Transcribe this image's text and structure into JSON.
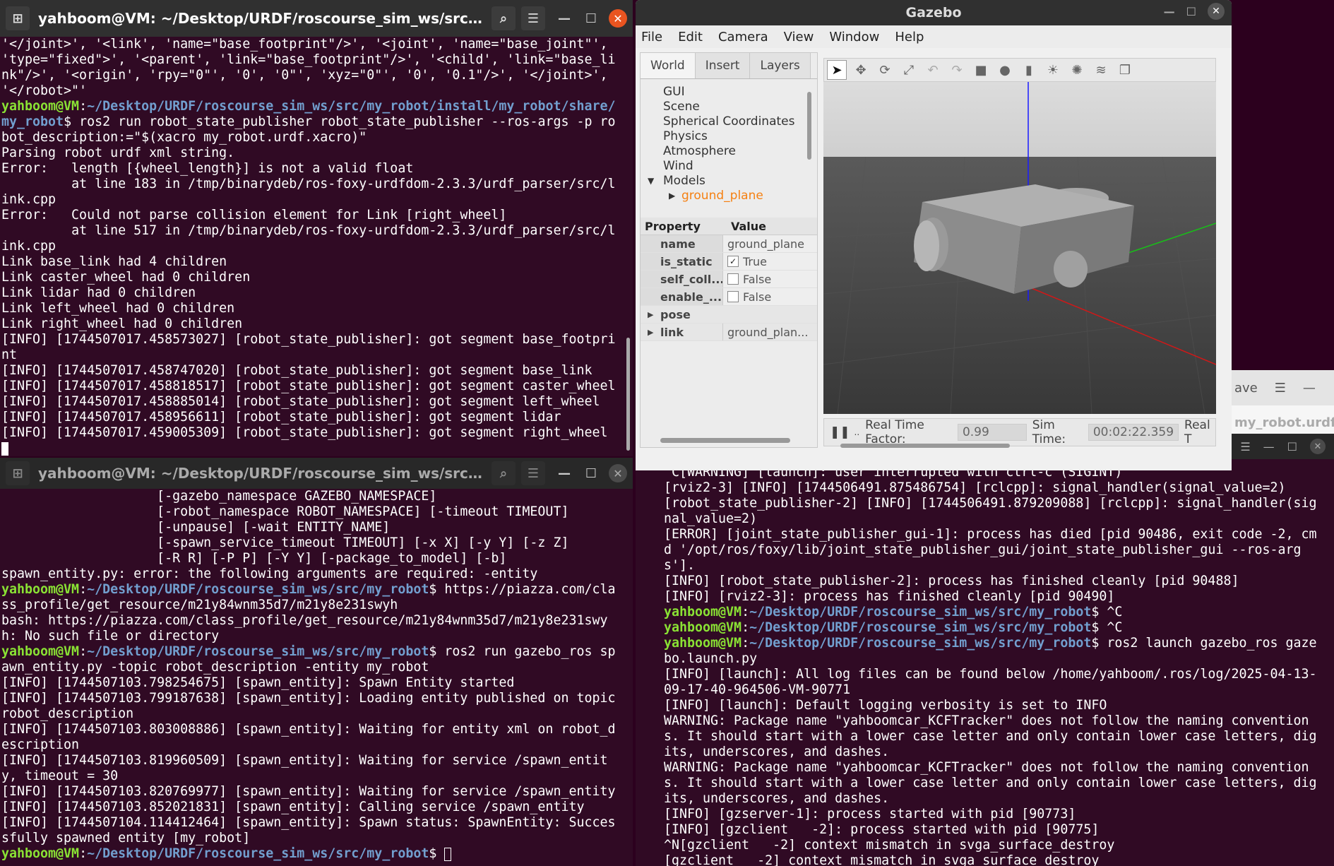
{
  "term1": {
    "title": "yahboom@VM: ~/Desktop/URDF/roscourse_sim_ws/src/my_robot/i...",
    "lines": [
      {
        "t": "'</joint>', '<link', 'name=\"base_footprint\"/>', '<joint', 'name=\"base_joint\"', 'type=\"fixed\">', '<parent', 'link=\"base_footprint\"/>', '<child', 'link=\"base_link\"/>', '<origin', 'rpy=\"0\"', '0', '0\"', 'xyz=\"0\"', '0', '0.1\"/>', '</joint>', '</robot>\"'"
      },
      {
        "user": "yahboom@VM",
        "path": "~/Desktop/URDF/roscourse_sim_ws/src/my_robot/install/my_robot/share/my_robot",
        "cmd": "ros2 run robot_state_publisher robot_state_publisher --ros-args -p robot_description:=\"$(xacro my_robot.urdf.xacro)\""
      },
      {
        "t": "Parsing robot urdf xml string."
      },
      {
        "t": "Error:   length [{wheel_length}] is not a valid float"
      },
      {
        "t": "         at line 183 in /tmp/binarydeb/ros-foxy-urdfdom-2.3.3/urdf_parser/src/link.cpp"
      },
      {
        "t": "Error:   Could not parse collision element for Link [right_wheel]"
      },
      {
        "t": "         at line 517 in /tmp/binarydeb/ros-foxy-urdfdom-2.3.3/urdf_parser/src/link.cpp"
      },
      {
        "t": "Link base_link had 4 children"
      },
      {
        "t": "Link caster_wheel had 0 children"
      },
      {
        "t": "Link lidar had 0 children"
      },
      {
        "t": "Link left_wheel had 0 children"
      },
      {
        "t": "Link right_wheel had 0 children"
      },
      {
        "t": "[INFO] [1744507017.458573027] [robot_state_publisher]: got segment base_footprint"
      },
      {
        "t": "[INFO] [1744507017.458747020] [robot_state_publisher]: got segment base_link"
      },
      {
        "t": "[INFO] [1744507017.458818517] [robot_state_publisher]: got segment caster_wheel"
      },
      {
        "t": "[INFO] [1744507017.458885014] [robot_state_publisher]: got segment left_wheel"
      },
      {
        "t": "[INFO] [1744507017.458956611] [robot_state_publisher]: got segment lidar"
      },
      {
        "t": "[INFO] [1744507017.459005309] [robot_state_publisher]: got segment right_wheel"
      }
    ]
  },
  "term2": {
    "title": "yahboom@VM: ~/Desktop/URDF/roscourse_sim_ws/src/my_robot",
    "lines": [
      {
        "t": "                    [-gazebo_namespace GAZEBO_NAMESPACE]"
      },
      {
        "t": "                    [-robot_namespace ROBOT_NAMESPACE] [-timeout TIMEOUT]"
      },
      {
        "t": "                    [-unpause] [-wait ENTITY_NAME]"
      },
      {
        "t": "                    [-spawn_service_timeout TIMEOUT] [-x X] [-y Y] [-z Z]"
      },
      {
        "t": "                    [-R R] [-P P] [-Y Y] [-package_to_model] [-b]"
      },
      {
        "t": "spawn_entity.py: error: the following arguments are required: -entity"
      },
      {
        "user": "yahboom@VM",
        "path": "~/Desktop/URDF/roscourse_sim_ws/src/my_robot",
        "cmd": "https://piazza.com/class_profile/get_resource/m21y84wnm35d7/m21y8e231swyh"
      },
      {
        "t": "bash: https://piazza.com/class_profile/get_resource/m21y84wnm35d7/m21y8e231swyh: No such file or directory"
      },
      {
        "user": "yahboom@VM",
        "path": "~/Desktop/URDF/roscourse_sim_ws/src/my_robot",
        "cmd": "ros2 run gazebo_ros spawn_entity.py -topic robot_description -entity my_robot"
      },
      {
        "t": "[INFO] [1744507103.798254675] [spawn_entity]: Spawn Entity started"
      },
      {
        "t": "[INFO] [1744507103.799187638] [spawn_entity]: Loading entity published on topic robot_description"
      },
      {
        "t": "[INFO] [1744507103.803008886] [spawn_entity]: Waiting for entity xml on robot_description"
      },
      {
        "t": "[INFO] [1744507103.819960509] [spawn_entity]: Waiting for service /spawn_entity, timeout = 30"
      },
      {
        "t": "[INFO] [1744507103.820769977] [spawn_entity]: Waiting for service /spawn_entity"
      },
      {
        "t": "[INFO] [1744507103.852021831] [spawn_entity]: Calling service /spawn_entity"
      },
      {
        "t": "[INFO] [1744507104.114412464] [spawn_entity]: Spawn status: SpawnEntity: Successfully spawned entity [my_robot]"
      },
      {
        "user": "yahboom@VM",
        "path": "~/Desktop/URDF/roscourse_sim_ws/src/my_robot",
        "cmd": ""
      }
    ]
  },
  "term3": {
    "lines": [
      {
        "t": "^C[WARNING] [launch]: user interrupted with ctrl-c (SIGINT)"
      },
      {
        "t": "[rviz2-3] [INFO] [1744506491.875486754] [rclcpp]: signal_handler(signal_value=2)"
      },
      {
        "t": "[robot_state_publisher-2] [INFO] [1744506491.879209088] [rclcpp]: signal_handler(signal_value=2)"
      },
      {
        "t": "[ERROR] [joint_state_publisher_gui-1]: process has died [pid 90486, exit code -2, cmd '/opt/ros/foxy/lib/joint_state_publisher_gui/joint_state_publisher_gui --ros-args']."
      },
      {
        "t": "[INFO] [robot_state_publisher-2]: process has finished cleanly [pid 90488]"
      },
      {
        "t": "[INFO] [rviz2-3]: process has finished cleanly [pid 90490]"
      },
      {
        "user": "yahboom@VM",
        "path": "~/Desktop/URDF/roscourse_sim_ws/src/my_robot",
        "cmd": "^C"
      },
      {
        "user": "yahboom@VM",
        "path": "~/Desktop/URDF/roscourse_sim_ws/src/my_robot",
        "cmd": "^C"
      },
      {
        "user": "yahboom@VM",
        "path": "~/Desktop/URDF/roscourse_sim_ws/src/my_robot",
        "cmd": "ros2 launch gazebo_ros gazebo.launch.py"
      },
      {
        "t": "[INFO] [launch]: All log files can be found below /home/yahboom/.ros/log/2025-04-13-09-17-40-964506-VM-90771"
      },
      {
        "t": "[INFO] [launch]: Default logging verbosity is set to INFO"
      },
      {
        "t": "WARNING: Package name \"yahboomcar_KCFTracker\" does not follow the naming conventions. It should start with a lower case letter and only contain lower case letters, digits, underscores, and dashes."
      },
      {
        "t": "WARNING: Package name \"yahboomcar_KCFTracker\" does not follow the naming conventions. It should start with a lower case letter and only contain lower case letters, digits, underscores, and dashes."
      },
      {
        "t": "[INFO] [gzserver-1]: process started with pid [90773]"
      },
      {
        "t": "[INFO] [gzclient   -2]: process started with pid [90775]"
      },
      {
        "t": "^N[gzclient   -2] context mismatch in svga_surface_destroy"
      },
      {
        "t": "[gzclient   -2] context mismatch in svga_surface_destroy"
      }
    ]
  },
  "gazebo": {
    "title": "Gazebo",
    "menu": [
      "File",
      "Edit",
      "Camera",
      "View",
      "Window",
      "Help"
    ],
    "tabs": [
      "World",
      "Insert",
      "Layers"
    ],
    "tree": [
      "GUI",
      "Scene",
      "Spherical Coordinates",
      "Physics",
      "Atmosphere",
      "Wind"
    ],
    "models_label": "Models",
    "ground_plane": "ground_plane",
    "prop_header": {
      "property": "Property",
      "value": "Value"
    },
    "props": {
      "name_k": "name",
      "name_v": "ground_plane",
      "static_k": "is_static",
      "static_v": "True",
      "selfc_k": "self_coll...",
      "selfc_v": "False",
      "enable_k": "enable_...",
      "enable_v": "False",
      "pose_k": "pose",
      "link_k": "link",
      "link_v": "ground_plan..."
    },
    "rtf_label": "Real Time Factor:",
    "rtf_value": "0.99",
    "sim_label": "Sim Time:",
    "sim_value": "00:02:22.359",
    "real_label": "Real T"
  },
  "editor": {
    "save": "ave",
    "file": "my_robot.urdf"
  },
  "colors": {
    "terminal_bg": "#300a24",
    "prompt_user": "#8ae234",
    "prompt_path": "#729fcf",
    "ground_plane": "#f58113"
  }
}
